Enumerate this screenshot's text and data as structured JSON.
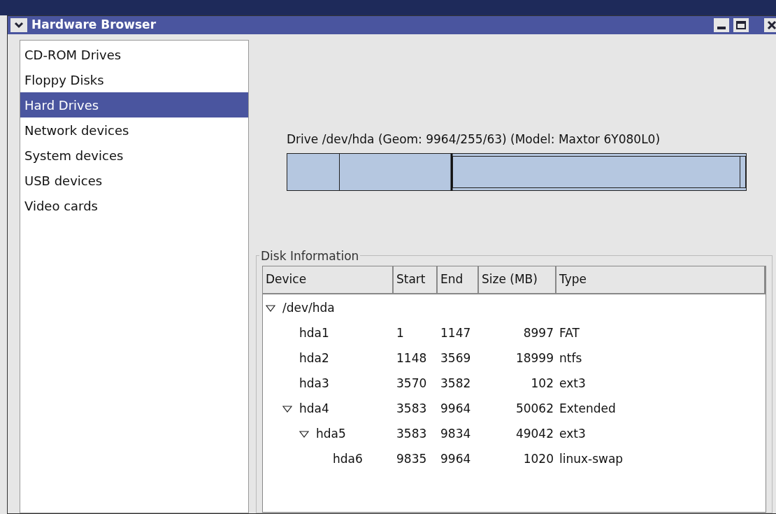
{
  "window": {
    "title": "Hardware Browser"
  },
  "sidebar": {
    "items": [
      {
        "label": "CD-ROM Drives",
        "selected": false
      },
      {
        "label": "Floppy Disks",
        "selected": false
      },
      {
        "label": "Hard Drives",
        "selected": true
      },
      {
        "label": "Network devices",
        "selected": false
      },
      {
        "label": "System devices",
        "selected": false
      },
      {
        "label": "USB devices",
        "selected": false
      },
      {
        "label": "Video cards",
        "selected": false
      }
    ]
  },
  "drive_label": "Drive /dev/hda (Geom: 9964/255/63) (Model: Maxtor 6Y080L0)",
  "disk_information": {
    "title": "Disk Information",
    "columns": [
      "Device",
      "Start",
      "End",
      "Size (MB)",
      "Type"
    ],
    "rows": [
      {
        "device": "/dev/hda",
        "expanded": true,
        "children": [
          {
            "device": "hda1",
            "start": "1",
            "end": "1147",
            "size": "8997",
            "type": "FAT"
          },
          {
            "device": "hda2",
            "start": "1148",
            "end": "3569",
            "size": "18999",
            "type": "ntfs"
          },
          {
            "device": "hda3",
            "start": "3570",
            "end": "3582",
            "size": "102",
            "type": "ext3"
          },
          {
            "device": "hda4",
            "start": "3583",
            "end": "9964",
            "size": "50062",
            "type": "Extended",
            "expanded": true,
            "children": [
              {
                "device": "hda5",
                "start": "3583",
                "end": "9834",
                "size": "49042",
                "type": "ext3",
                "expanded": true,
                "children": [
                  {
                    "device": "hda6",
                    "start": "9835",
                    "end": "9964",
                    "size": "1020",
                    "type": "linux-swap"
                  }
                ]
              }
            ]
          }
        ]
      }
    ]
  }
}
